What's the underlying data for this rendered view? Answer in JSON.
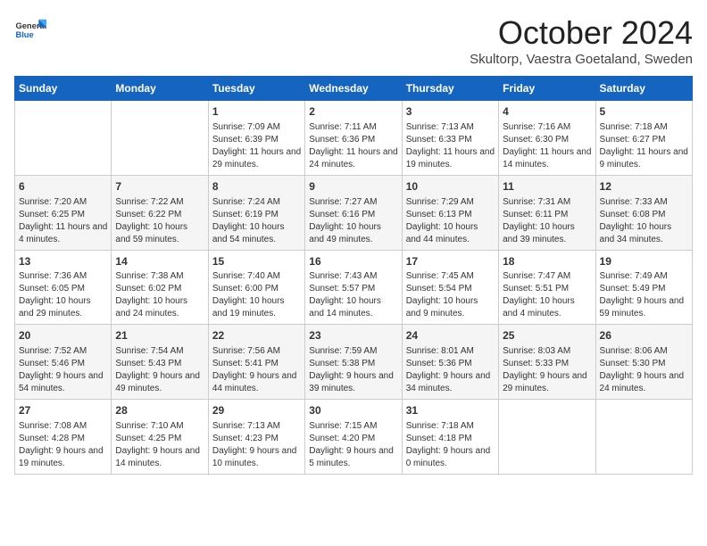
{
  "header": {
    "logo_general": "General",
    "logo_blue": "Blue",
    "title": "October 2024",
    "subtitle": "Skultorp, Vaestra Goetaland, Sweden"
  },
  "days_of_week": [
    "Sunday",
    "Monday",
    "Tuesday",
    "Wednesday",
    "Thursday",
    "Friday",
    "Saturday"
  ],
  "weeks": [
    [
      {
        "day": "",
        "content": ""
      },
      {
        "day": "",
        "content": ""
      },
      {
        "day": "1",
        "content": "Sunrise: 7:09 AM\nSunset: 6:39 PM\nDaylight: 11 hours and 29 minutes."
      },
      {
        "day": "2",
        "content": "Sunrise: 7:11 AM\nSunset: 6:36 PM\nDaylight: 11 hours and 24 minutes."
      },
      {
        "day": "3",
        "content": "Sunrise: 7:13 AM\nSunset: 6:33 PM\nDaylight: 11 hours and 19 minutes."
      },
      {
        "day": "4",
        "content": "Sunrise: 7:16 AM\nSunset: 6:30 PM\nDaylight: 11 hours and 14 minutes."
      },
      {
        "day": "5",
        "content": "Sunrise: 7:18 AM\nSunset: 6:27 PM\nDaylight: 11 hours and 9 minutes."
      }
    ],
    [
      {
        "day": "6",
        "content": "Sunrise: 7:20 AM\nSunset: 6:25 PM\nDaylight: 11 hours and 4 minutes."
      },
      {
        "day": "7",
        "content": "Sunrise: 7:22 AM\nSunset: 6:22 PM\nDaylight: 10 hours and 59 minutes."
      },
      {
        "day": "8",
        "content": "Sunrise: 7:24 AM\nSunset: 6:19 PM\nDaylight: 10 hours and 54 minutes."
      },
      {
        "day": "9",
        "content": "Sunrise: 7:27 AM\nSunset: 6:16 PM\nDaylight: 10 hours and 49 minutes."
      },
      {
        "day": "10",
        "content": "Sunrise: 7:29 AM\nSunset: 6:13 PM\nDaylight: 10 hours and 44 minutes."
      },
      {
        "day": "11",
        "content": "Sunrise: 7:31 AM\nSunset: 6:11 PM\nDaylight: 10 hours and 39 minutes."
      },
      {
        "day": "12",
        "content": "Sunrise: 7:33 AM\nSunset: 6:08 PM\nDaylight: 10 hours and 34 minutes."
      }
    ],
    [
      {
        "day": "13",
        "content": "Sunrise: 7:36 AM\nSunset: 6:05 PM\nDaylight: 10 hours and 29 minutes."
      },
      {
        "day": "14",
        "content": "Sunrise: 7:38 AM\nSunset: 6:02 PM\nDaylight: 10 hours and 24 minutes."
      },
      {
        "day": "15",
        "content": "Sunrise: 7:40 AM\nSunset: 6:00 PM\nDaylight: 10 hours and 19 minutes."
      },
      {
        "day": "16",
        "content": "Sunrise: 7:43 AM\nSunset: 5:57 PM\nDaylight: 10 hours and 14 minutes."
      },
      {
        "day": "17",
        "content": "Sunrise: 7:45 AM\nSunset: 5:54 PM\nDaylight: 10 hours and 9 minutes."
      },
      {
        "day": "18",
        "content": "Sunrise: 7:47 AM\nSunset: 5:51 PM\nDaylight: 10 hours and 4 minutes."
      },
      {
        "day": "19",
        "content": "Sunrise: 7:49 AM\nSunset: 5:49 PM\nDaylight: 9 hours and 59 minutes."
      }
    ],
    [
      {
        "day": "20",
        "content": "Sunrise: 7:52 AM\nSunset: 5:46 PM\nDaylight: 9 hours and 54 minutes."
      },
      {
        "day": "21",
        "content": "Sunrise: 7:54 AM\nSunset: 5:43 PM\nDaylight: 9 hours and 49 minutes."
      },
      {
        "day": "22",
        "content": "Sunrise: 7:56 AM\nSunset: 5:41 PM\nDaylight: 9 hours and 44 minutes."
      },
      {
        "day": "23",
        "content": "Sunrise: 7:59 AM\nSunset: 5:38 PM\nDaylight: 9 hours and 39 minutes."
      },
      {
        "day": "24",
        "content": "Sunrise: 8:01 AM\nSunset: 5:36 PM\nDaylight: 9 hours and 34 minutes."
      },
      {
        "day": "25",
        "content": "Sunrise: 8:03 AM\nSunset: 5:33 PM\nDaylight: 9 hours and 29 minutes."
      },
      {
        "day": "26",
        "content": "Sunrise: 8:06 AM\nSunset: 5:30 PM\nDaylight: 9 hours and 24 minutes."
      }
    ],
    [
      {
        "day": "27",
        "content": "Sunrise: 7:08 AM\nSunset: 4:28 PM\nDaylight: 9 hours and 19 minutes."
      },
      {
        "day": "28",
        "content": "Sunrise: 7:10 AM\nSunset: 4:25 PM\nDaylight: 9 hours and 14 minutes."
      },
      {
        "day": "29",
        "content": "Sunrise: 7:13 AM\nSunset: 4:23 PM\nDaylight: 9 hours and 10 minutes."
      },
      {
        "day": "30",
        "content": "Sunrise: 7:15 AM\nSunset: 4:20 PM\nDaylight: 9 hours and 5 minutes."
      },
      {
        "day": "31",
        "content": "Sunrise: 7:18 AM\nSunset: 4:18 PM\nDaylight: 9 hours and 0 minutes."
      },
      {
        "day": "",
        "content": ""
      },
      {
        "day": "",
        "content": ""
      }
    ]
  ]
}
